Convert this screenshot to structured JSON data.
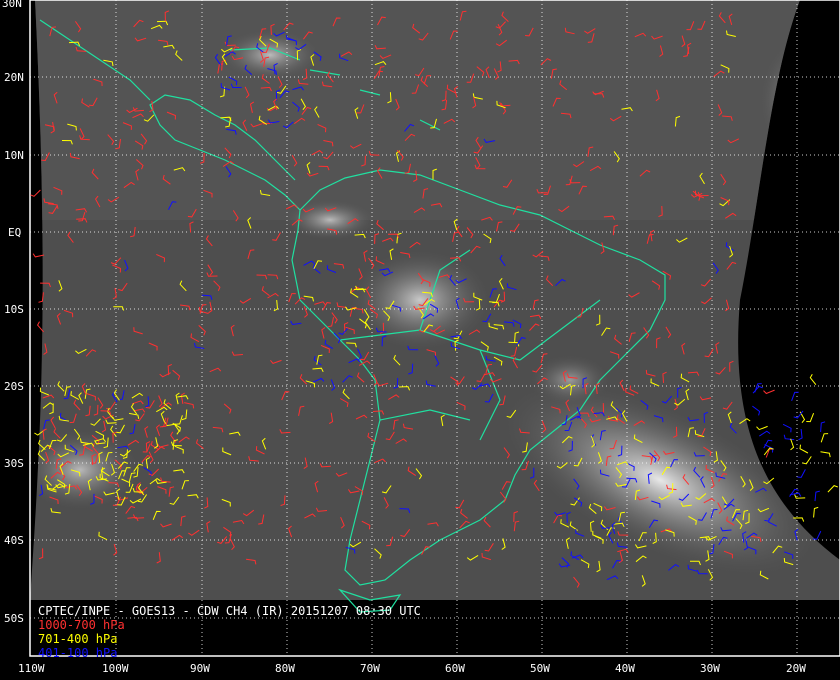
{
  "map": {
    "title": "CPTEC/INPE - GOES13 - CDW CH4 (IR) 20151207 08:30 UTC",
    "legend": [
      {
        "label": "1000-700 hPa",
        "color": "#ff3030"
      },
      {
        "label": "701-400 hPa",
        "color": "#ffff00"
      },
      {
        "label": "401-100 hPa",
        "color": "#1010ff"
      }
    ],
    "lat_labels": [
      "30N",
      "20N",
      "10N",
      "EQ",
      "10S",
      "20S",
      "30S",
      "40S",
      "50S"
    ],
    "lon_labels": [
      "110W",
      "100W",
      "90W",
      "80W",
      "70W",
      "60W",
      "50W",
      "40W",
      "30W",
      "20W"
    ],
    "colors": {
      "coast": "#20e0a0",
      "grid": "#ffffff",
      "background": "#000000",
      "cloud_gray": "#5a5a5a"
    }
  }
}
